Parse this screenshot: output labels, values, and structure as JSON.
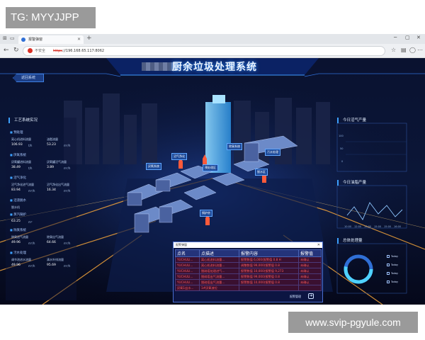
{
  "watermark": {
    "top": "TG: MYYJJPP",
    "bottom": "www.svip-pgyule.com"
  },
  "browser": {
    "tab_title": "报警弹窗",
    "new_tab": "+",
    "security_text": "不安全",
    "url_scheme": "https",
    "url_rest": "://196.168.65.117:8062",
    "icons": {
      "back": "arrow-left-icon",
      "forward": "arrow-right-icon",
      "reload": "reload-icon"
    }
  },
  "dashboard": {
    "title": "厨余垃圾处理系统",
    "back_button": "返回系统",
    "left_panel": {
      "title": "工艺系统实况",
      "sections": [
        {
          "label": "预处理",
          "metrics": [
            {
              "label": "离心机进料流量",
              "value": "106.93",
              "unit": "t/h"
            },
            {
              "label": "油脂流量",
              "value": "53.23",
              "unit": "m³/h"
            }
          ]
        },
        {
          "label": "厌氧系统",
          "metrics": [
            {
              "label": "厌氧罐进料流量",
              "value": "38.49",
              "unit": "t/h"
            },
            {
              "label": "厌氧罐沼气流量",
              "value": "3.89",
              "unit": "m³/h"
            }
          ]
        },
        {
          "label": "沼气净化",
          "metrics": [
            {
              "label": "沼气净化进气流量",
              "value": "83.94",
              "unit": "m³/h"
            },
            {
              "label": "沼气净化出气流量",
              "value": "16.34",
              "unit": "m³/h"
            }
          ]
        },
        {
          "label": "沼渣脱水",
          "metrics": [
            {
              "label": "脱水机",
              "value": "",
              "unit": ""
            }
          ]
        },
        {
          "label": "蒸汽锅炉",
          "metrics": [
            {
              "label": "",
              "value": "63.25",
              "unit": "m³"
            }
          ]
        },
        {
          "label": "除臭系统",
          "metrics": [
            {
              "label": "除臭进气流量",
              "value": "49.96",
              "unit": "m³/h"
            },
            {
              "label": "除臭出气流量",
              "value": "64.66",
              "unit": "m³/h"
            }
          ]
        },
        {
          "label": "污水处理",
          "metrics": [
            {
              "label": "调节池进水流量",
              "value": "49.96",
              "unit": "m³/h"
            },
            {
              "label": "清水外排流量",
              "value": "95.69",
              "unit": "m³/h"
            }
          ]
        }
      ]
    },
    "building_labels": [
      "厌氧系统",
      "沼气净化",
      "预处理区",
      "除臭系统",
      "污水处理",
      "脱水区",
      "锅炉房"
    ],
    "right_panel": {
      "biogas_title": "今日沼气产量",
      "biogas_y_ticks": [
        "100",
        "50",
        "0"
      ],
      "oil_title": "今日油脂产量",
      "oil_x_ticks": [
        "10:00",
        "12:00",
        "13:00",
        "15:00",
        "15:00",
        "16:00"
      ],
      "total_title": "总体处理量",
      "legend": [
        "Today",
        "Today",
        "Today",
        "Today"
      ]
    },
    "alarm": {
      "window_title": "报警弹窗",
      "columns": [
        "点名",
        "点描述",
        "报警内容",
        "报警值"
      ],
      "rows": [
        [
          "YUCHULI...",
          "离心机进料流量...",
          "报警数值 6,000(报警值 0.8 H",
          "未确认"
        ],
        [
          "YUCHULI...",
          "离心机进料流量...",
          "调整数值 99,000(报警值 0.8",
          "未确认"
        ],
        [
          "YUCHULI...",
          "脱硫塔处理进气...",
          "报警数值 10,000(报警值 9,273",
          "未确认"
        ],
        [
          "YUCHULI...",
          "脱硫塔出气流量...",
          "报警数值 99,000(报警值 0.8",
          "未确认"
        ],
        [
          "YUCHULI...",
          "脱硫塔出气流量...",
          "报警数值 10,000(报警值 0.8",
          "未确认"
        ],
        [
          "厌氧1出水...",
          "1#厌氧液位",
          "",
          ""
        ]
      ],
      "more_label": "报警管理",
      "more_icon": "arrow-right-icon"
    }
  }
}
